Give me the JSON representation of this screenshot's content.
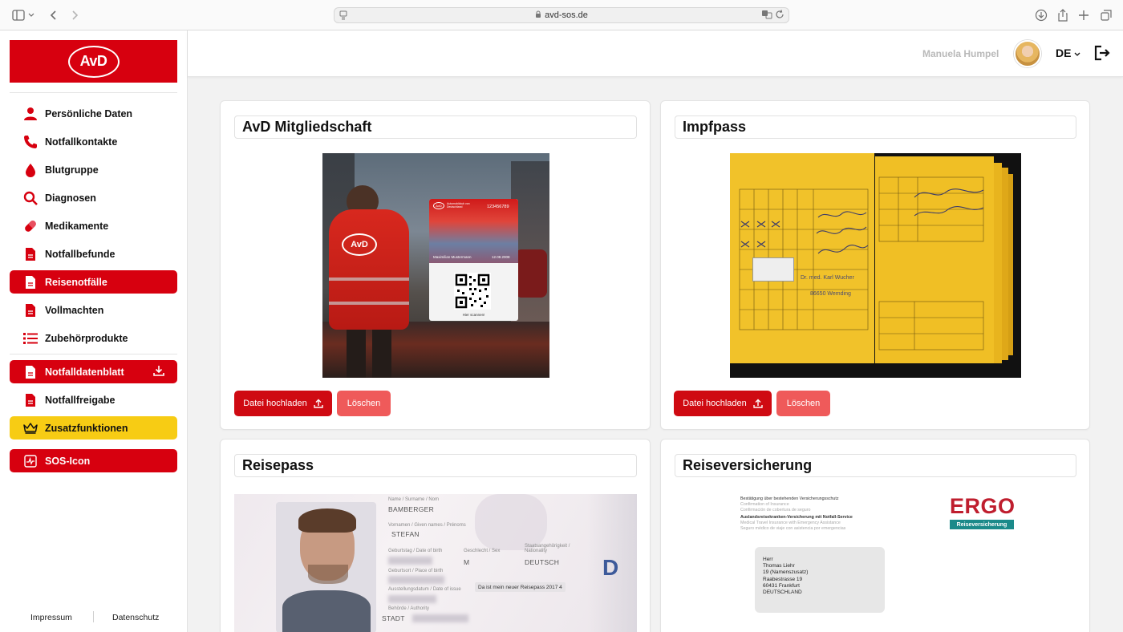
{
  "browser": {
    "url": "avd-sos.de"
  },
  "sidebar": {
    "logo_text": "AvD",
    "items": [
      {
        "label": "Persönliche Daten",
        "icon": "person-icon"
      },
      {
        "label": "Notfallkontakte",
        "icon": "phone-icon"
      },
      {
        "label": "Blutgruppe",
        "icon": "blood-drop-icon"
      },
      {
        "label": "Diagnosen",
        "icon": "search-icon"
      },
      {
        "label": "Medikamente",
        "icon": "pill-icon"
      },
      {
        "label": "Notfallbefunde",
        "icon": "document-icon"
      },
      {
        "label": "Reisenotfälle",
        "icon": "document-icon",
        "active": true
      },
      {
        "label": "Vollmachten",
        "icon": "document-icon"
      },
      {
        "label": "Zubehörprodukte",
        "icon": "list-icon"
      },
      {
        "label": "Notfalldatenblatt",
        "icon": "document-icon"
      },
      {
        "label": "Notfallfreigabe",
        "icon": "document-icon"
      },
      {
        "label": "Zusatzfunktionen",
        "icon": "crown-icon"
      },
      {
        "label": "SOS-Icon",
        "icon": "pulse-icon"
      }
    ],
    "footer": {
      "impressum": "Impressum",
      "datenschutz": "Datenschutz"
    }
  },
  "header": {
    "user_name": "Manuela Humpel",
    "language": "DE"
  },
  "cards": {
    "membership": {
      "title": "AvD Mitgliedschaft",
      "member_card": {
        "club": "Automobilclub von Deutschland",
        "number": "123456789",
        "name": "Maximilian Mustermann",
        "date": "12.08.2008",
        "scan": "Hier scannen!"
      },
      "upload_label": "Datei hochladen",
      "delete_label": "Löschen"
    },
    "vaccination": {
      "title": "Impfpass",
      "doctor_stamp": "Dr. med. Karl Wucher",
      "stamp_city": "86650 Wemding",
      "upload_label": "Datei hochladen",
      "delete_label": "Löschen"
    },
    "passport": {
      "title": "Reisepass",
      "name": "BAMBERGER",
      "given_name": "STEFAN",
      "sex": "M",
      "nationality": "DEUTSCH",
      "authority": "STADT",
      "country_letter": "D",
      "tooltip": "Da ist mein neuer Reisepass 2017 4",
      "labels": {
        "surname": "Name / Surname / Nom",
        "given": "Vornamen / Given names / Prénoms",
        "birth": "Geburtstag / Date of birth",
        "sex": "Geschlecht / Sex",
        "nationality": "Staatsangehörigkeit / Nationality",
        "place": "Geburtsort / Place of birth",
        "issue": "Ausstellungsdatum / Date of issue",
        "authority": "Behörde / Authority"
      }
    },
    "insurance": {
      "title": "Reiseversicherung",
      "brand": "ERGO",
      "brand_sub": "Reiseversicherung",
      "lines": [
        "Bestätigung über bestehenden Versicherungsschutz",
        "Confirmation of Insurance",
        "Confirmación de cobertura de seguro",
        "Auslandsreisekranken-Versicherung mit Notfall-Service",
        "Medical Travel Insurance with Emergency Assistance",
        "Seguro médico de viaje con asistencia por emergencias"
      ],
      "address": [
        "Herr",
        "Thomas Liehr",
        "19 (Namenszusatz)",
        "Raabestrasse 19",
        "60431 Frankfurt",
        "DEUTSCHLAND"
      ]
    }
  },
  "colors": {
    "brand_red": "#d7000f",
    "delete_red": "#ef5a5a",
    "premium_yellow": "#f7cc14"
  }
}
